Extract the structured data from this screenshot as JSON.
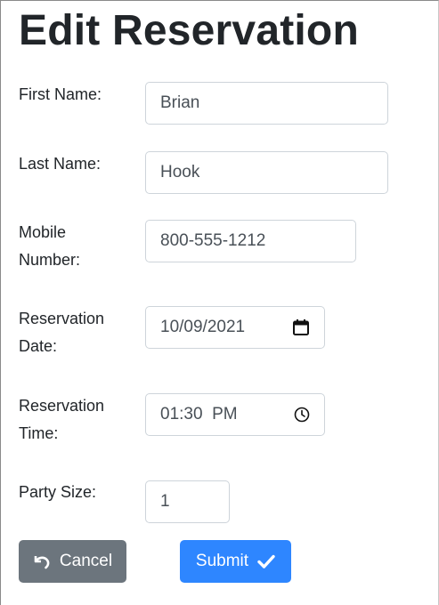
{
  "page": {
    "title": "Edit Reservation"
  },
  "form": {
    "first_name": {
      "label": "First Name:",
      "value": "Brian"
    },
    "last_name": {
      "label": "Last Name:",
      "value": "Hook"
    },
    "mobile_number": {
      "label_line1": "Mobile",
      "label_line2": "Number:",
      "value": "800-555-1212"
    },
    "reservation_date": {
      "label_line1": "Reservation",
      "label_line2": "Date:",
      "value": "10/09/2021",
      "icon": "calendar-icon"
    },
    "reservation_time": {
      "label_line1": "Reservation",
      "label_line2": "Time:",
      "value": "01:30  PM",
      "icon": "clock-icon"
    },
    "party_size": {
      "label": "Party Size:",
      "value": "1"
    }
  },
  "actions": {
    "cancel_label": "Cancel",
    "cancel_icon": "undo-arrow-icon",
    "submit_label": "Submit",
    "submit_icon": "checkmark-icon"
  },
  "colors": {
    "cancel_bg": "#6c757d",
    "submit_bg": "#2e86ff",
    "field_border": "#ced4da",
    "text": "#212529"
  }
}
